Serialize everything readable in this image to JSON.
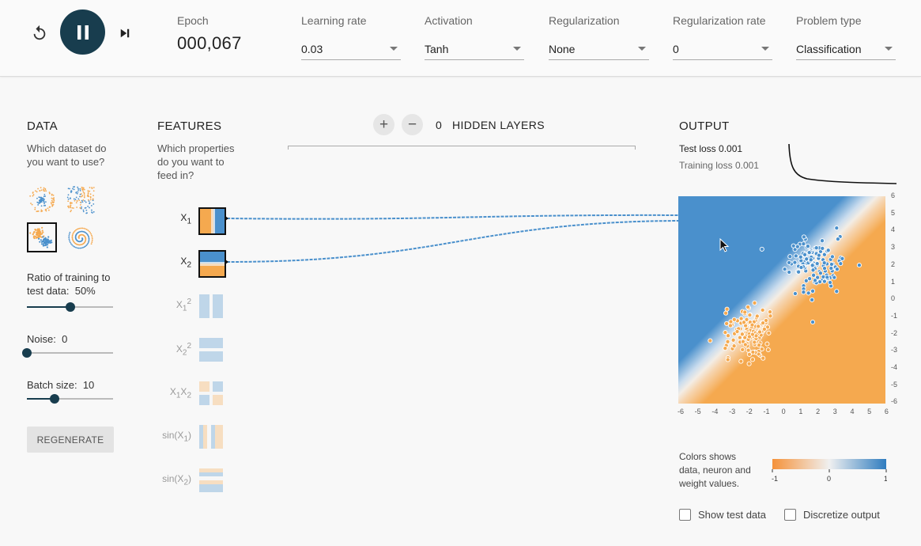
{
  "controls": {
    "reset_icon": "reset-icon",
    "play_icon": "pause-icon",
    "step_icon": "step-forward-icon",
    "epoch_label": "Epoch",
    "epoch_value": "000,067"
  },
  "settings": [
    {
      "label": "Learning rate",
      "value": "0.03"
    },
    {
      "label": "Activation",
      "value": "Tanh"
    },
    {
      "label": "Regularization",
      "value": "None"
    },
    {
      "label": "Regularization rate",
      "value": "0"
    },
    {
      "label": "Problem type",
      "value": "Classification"
    }
  ],
  "data": {
    "title": "DATA",
    "subtitle_line1": "Which dataset do",
    "subtitle_line2": "you want to use?",
    "ratio_label_line1": "Ratio of training to",
    "ratio_label_line2": "test data:",
    "ratio_value": "50%",
    "ratio_fraction": 0.5,
    "noise_label": "Noise:",
    "noise_value": "0",
    "noise_fraction": 0,
    "batch_label": "Batch size:",
    "batch_value": "10",
    "batch_fraction": 0.32,
    "regenerate_label": "REGENERATE"
  },
  "features": {
    "title": "FEATURES",
    "subtitle_line1": "Which properties",
    "subtitle_line2": "do you want to",
    "subtitle_line3": "feed in?",
    "items": [
      {
        "base": "X",
        "sub": "1",
        "sup": "",
        "pre": "",
        "post": ""
      },
      {
        "base": "X",
        "sub": "2",
        "sup": "",
        "pre": "",
        "post": ""
      },
      {
        "base": "X",
        "sub": "1",
        "sup": "2",
        "pre": "",
        "post": ""
      },
      {
        "base": "X",
        "sub": "2",
        "sup": "2",
        "pre": "",
        "post": ""
      },
      {
        "base": "X",
        "sub": "1",
        "sup": "",
        "pre": "",
        "post": "X"
      },
      {
        "base": "X",
        "sub": "1",
        "sup": "",
        "pre": "sin(",
        "post": ")"
      },
      {
        "base": "X",
        "sub": "2",
        "sup": "",
        "pre": "sin(",
        "post": ")"
      }
    ],
    "x1x2_sub2": "2"
  },
  "network": {
    "add_label": "+",
    "remove_label": "−",
    "hidden_count": "0",
    "hidden_label": "HIDDEN LAYERS"
  },
  "output": {
    "title": "OUTPUT",
    "test_loss_label": "Test loss",
    "test_loss_value": "0.001",
    "training_loss_label": "Training loss",
    "training_loss_value": "0.001",
    "y_ticks": [
      "6",
      "5",
      "4",
      "3",
      "2",
      "1",
      "0",
      "-1",
      "-2",
      "-3",
      "-4",
      "-5",
      "-6"
    ],
    "x_ticks": [
      "-6",
      "-5",
      "-4",
      "-3",
      "-2",
      "-1",
      "0",
      "1",
      "2",
      "3",
      "4",
      "5",
      "6"
    ],
    "legend_line1": "Colors shows",
    "legend_line2": "data, neuron and",
    "legend_line3": "weight values.",
    "legend_min": "-1",
    "legend_mid": "0",
    "legend_max": "1",
    "show_test_label": "Show test data",
    "discretize_label": "Discretize output"
  },
  "colors": {
    "orange": "#f5a94f",
    "blue": "#4a90cc",
    "dark_accent": "#183d4e"
  }
}
